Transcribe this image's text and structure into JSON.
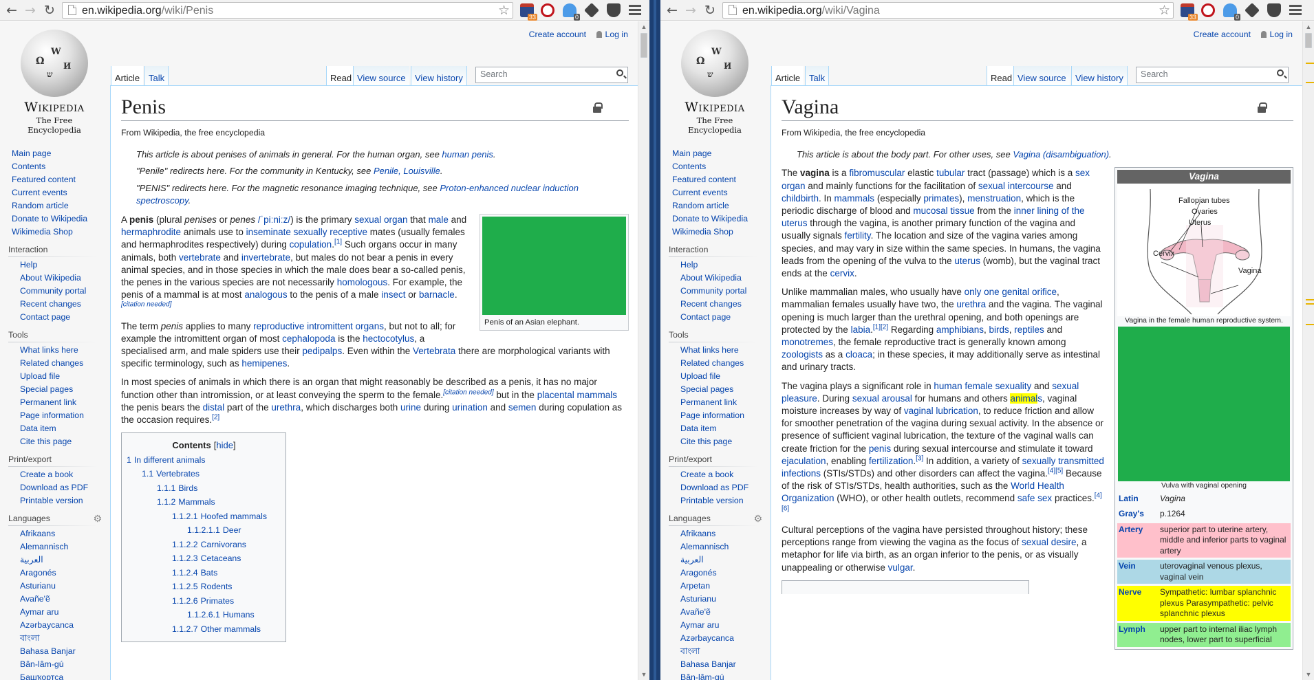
{
  "left": {
    "url": {
      "host": "en.wikipedia.org",
      "path": "/wiki/Penis"
    },
    "ext_badges": {
      "calendar": "33",
      "ghostery": "0"
    },
    "top_links": {
      "create": "Create account",
      "login": "Log in"
    },
    "tabs": {
      "article": "Article",
      "talk": "Talk",
      "read": "Read",
      "source": "View source",
      "history": "View history"
    },
    "search_placeholder": "Search",
    "title": "Penis",
    "subtitle": "From Wikipedia, the free encyclopedia",
    "hatnotes": [
      {
        "text": "This article is about penises of animals in general. For the human organ, see ",
        "link": "human penis",
        "end": "."
      },
      {
        "text": "\"Penile\" redirects here. For the community in Kentucky, see ",
        "link": "Penile, Louisville",
        "end": "."
      },
      {
        "text": "\"PENIS\" redirects here. For the magnetic resonance imaging technique, see ",
        "link": "Proton-enhanced nuclear induction spectroscopy",
        "end": "."
      }
    ],
    "thumb_caption": "Penis of an Asian elephant.",
    "toc": {
      "title": "Contents",
      "hide": "hide",
      "items": [
        {
          "num": "1",
          "label": "In different animals",
          "lvl": 0
        },
        {
          "num": "1.1",
          "label": "Vertebrates",
          "lvl": 1
        },
        {
          "num": "1.1.1",
          "label": "Birds",
          "lvl": 2
        },
        {
          "num": "1.1.2",
          "label": "Mammals",
          "lvl": 2
        },
        {
          "num": "1.1.2.1",
          "label": "Hoofed mammals",
          "lvl": 3
        },
        {
          "num": "1.1.2.1.1",
          "label": "Deer",
          "lvl": 4
        },
        {
          "num": "1.1.2.2",
          "label": "Carnivorans",
          "lvl": 3
        },
        {
          "num": "1.1.2.3",
          "label": "Cetaceans",
          "lvl": 3
        },
        {
          "num": "1.1.2.4",
          "label": "Bats",
          "lvl": 3
        },
        {
          "num": "1.1.2.5",
          "label": "Rodents",
          "lvl": 3
        },
        {
          "num": "1.1.2.6",
          "label": "Primates",
          "lvl": 3
        },
        {
          "num": "1.1.2.6.1",
          "label": "Humans",
          "lvl": 4
        },
        {
          "num": "1.1.2.7",
          "label": "Other mammals",
          "lvl": 3
        }
      ]
    }
  },
  "right": {
    "url": {
      "host": "en.wikipedia.org",
      "path": "/wiki/Vagina"
    },
    "ext_badges": {
      "calendar": "33",
      "ghostery": "0"
    },
    "top_links": {
      "create": "Create account",
      "login": "Log in"
    },
    "tabs": {
      "article": "Article",
      "talk": "Talk",
      "read": "Read",
      "source": "View source",
      "history": "View history"
    },
    "search_placeholder": "Search",
    "title": "Vagina",
    "subtitle": "From Wikipedia, the free encyclopedia",
    "hatnote": {
      "text": "This article is about the body part. For other uses, see ",
      "link": "Vagina (disambiguation)",
      "end": "."
    },
    "infobox": {
      "title": "Vagina",
      "diagram_labels": {
        "fallopian": "Fallopian tubes",
        "ovaries": "Ovaries",
        "uterus": "Uterus",
        "cervix": "Cervix",
        "vagina": "Vagina"
      },
      "diagram_caption": "Vagina in the female human reproductive system.",
      "image_caption": "Vulva with vaginal opening",
      "rows": [
        {
          "k": "Latin",
          "v": "Vagina",
          "bg": "#f8f9fa"
        },
        {
          "k": "Gray's",
          "v": "p.1264",
          "bg": "#f8f9fa"
        },
        {
          "k": "Artery",
          "v": "superior part to uterine artery, middle and inferior parts to vaginal artery",
          "bg": "#ffc0cb"
        },
        {
          "k": "Vein",
          "v": "uterovaginal venous plexus, vaginal vein",
          "bg": "#add8e6"
        },
        {
          "k": "Nerve",
          "v": "Sympathetic: lumbar splanchnic plexus Parasympathetic: pelvic splanchnic plexus",
          "bg": "#ffff00"
        },
        {
          "k": "Lymph",
          "v": "upper part to internal iliac lymph nodes, lower part to superficial",
          "bg": "#90ee90"
        }
      ]
    }
  },
  "sidebar": {
    "main": [
      "Main page",
      "Contents",
      "Featured content",
      "Current events",
      "Random article",
      "Donate to Wikipedia",
      "Wikimedia Shop"
    ],
    "interaction_title": "Interaction",
    "interaction": [
      "Help",
      "About Wikipedia",
      "Community portal",
      "Recent changes",
      "Contact page"
    ],
    "tools_title": "Tools",
    "tools": [
      "What links here",
      "Related changes",
      "Upload file",
      "Special pages",
      "Permanent link",
      "Page information",
      "Data item",
      "Cite this page"
    ],
    "print_title": "Print/export",
    "print": [
      "Create a book",
      "Download as PDF",
      "Printable version"
    ],
    "languages_title": "Languages",
    "languages_left": [
      "Afrikaans",
      "Alemannisch",
      "العربية",
      "Aragonés",
      "Asturianu",
      "Avañe'ẽ",
      "Aymar aru",
      "Azərbaycanca",
      "বাংলা",
      "Bahasa Banjar",
      "Bân-lâm-gú",
      "Башҡортса"
    ],
    "languages_right": [
      "Afrikaans",
      "Alemannisch",
      "العربية",
      "Aragonés",
      "Arpetan",
      "Asturianu",
      "Avañe'ẽ",
      "Aymar aru",
      "Azərbaycanca",
      "বাংলা",
      "Bahasa Banjar",
      "Bân-lâm-gú"
    ]
  },
  "logo": {
    "wordmark": "Wikipedia",
    "tagline": "The Free Encyclopedia"
  },
  "colors": {
    "link": "#0645ad",
    "placeholder_image": "#1fad4b",
    "highlight": "#ffff00",
    "desktop": "#1c3f73"
  }
}
